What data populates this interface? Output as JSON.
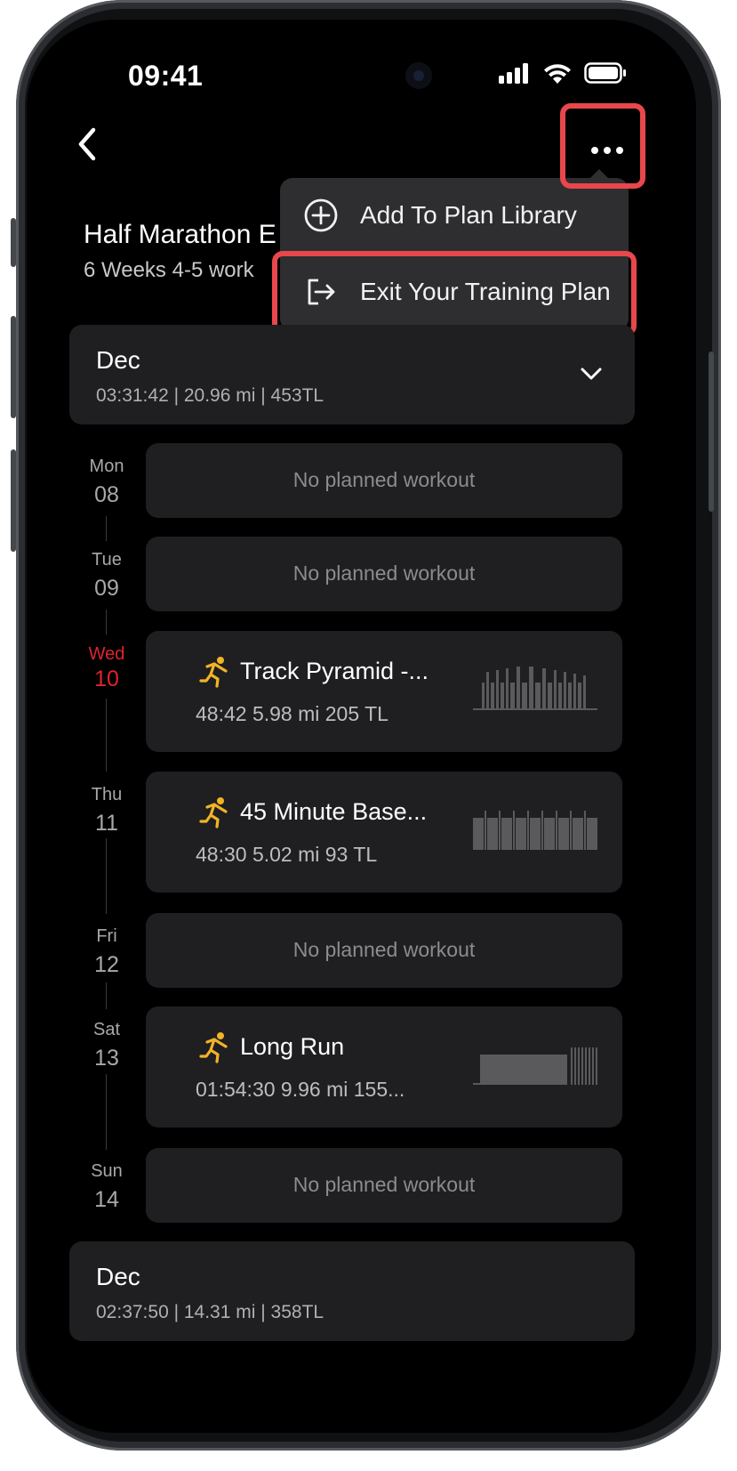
{
  "status": {
    "time": "09:41"
  },
  "header": {
    "back_icon": "chevron-left-icon",
    "more_icon": "more-horizontal-icon"
  },
  "menu": {
    "items": [
      {
        "label": "Add To Plan Library",
        "icon": "plus-circle-icon"
      },
      {
        "label": "Exit Your Training Plan",
        "icon": "exit-icon"
      }
    ]
  },
  "plan": {
    "title": "Half Marathon E",
    "subtitle": "6 Weeks  4-5 work"
  },
  "week1": {
    "month": "Dec",
    "summary": "03:31:42 | 20.96 mi | 453TL"
  },
  "days": [
    {
      "name": "Mon",
      "date": "08",
      "today": false
    },
    {
      "name": "Tue",
      "date": "09",
      "today": false
    },
    {
      "name": "Wed",
      "date": "10",
      "today": true
    },
    {
      "name": "Thu",
      "date": "11",
      "today": false
    },
    {
      "name": "Fri",
      "date": "12",
      "today": false
    },
    {
      "name": "Sat",
      "date": "13",
      "today": false
    },
    {
      "name": "Sun",
      "date": "14",
      "today": false
    }
  ],
  "workouts": {
    "empty_label": "No planned workout",
    "wed": {
      "title": "Track Pyramid -...",
      "stats": "48:42  5.98 mi  205 TL"
    },
    "thu": {
      "title": "45 Minute Base...",
      "stats": "48:30  5.02 mi  93 TL"
    },
    "sat": {
      "title": "Long Run",
      "stats": "01:54:30  9.96 mi  155..."
    }
  },
  "week2": {
    "month": "Dec",
    "summary": "02:37:50 | 14.31 mi | 358TL"
  },
  "colors": {
    "accent_red": "#e0232e",
    "highlight": "#e8474b",
    "run_icon": "#f2b327"
  }
}
